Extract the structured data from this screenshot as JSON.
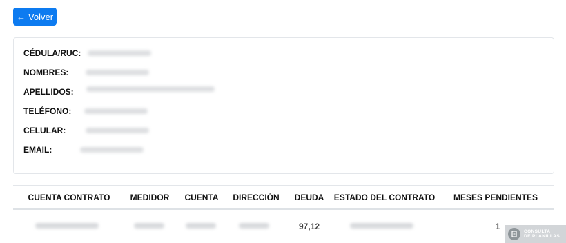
{
  "toolbar": {
    "back_label": "Volver",
    "back_icon": "arrow-left-icon"
  },
  "info": {
    "fields": [
      {
        "label": "CÉDULA/RUC:"
      },
      {
        "label": "NOMBRES:"
      },
      {
        "label": "APELLIDOS:"
      },
      {
        "label": "TELÉFONO:"
      },
      {
        "label": "CELULAR:"
      },
      {
        "label": "EMAIL:"
      }
    ]
  },
  "table": {
    "headers": [
      "CUENTA CONTRATO",
      "MEDIDOR",
      "CUENTA",
      "DIRECCIÓN",
      "DEUDA",
      "ESTADO DEL CONTRATO",
      "MESES PENDIENTES"
    ],
    "rows": [
      {
        "deuda": "97,12",
        "meses_pendientes": "1"
      }
    ]
  },
  "watermark": {
    "line1": "CONSULTA",
    "line2": "DE PLANILLAS"
  },
  "colors": {
    "primary": "#0d7bf0",
    "border": "#e3e6ea"
  }
}
